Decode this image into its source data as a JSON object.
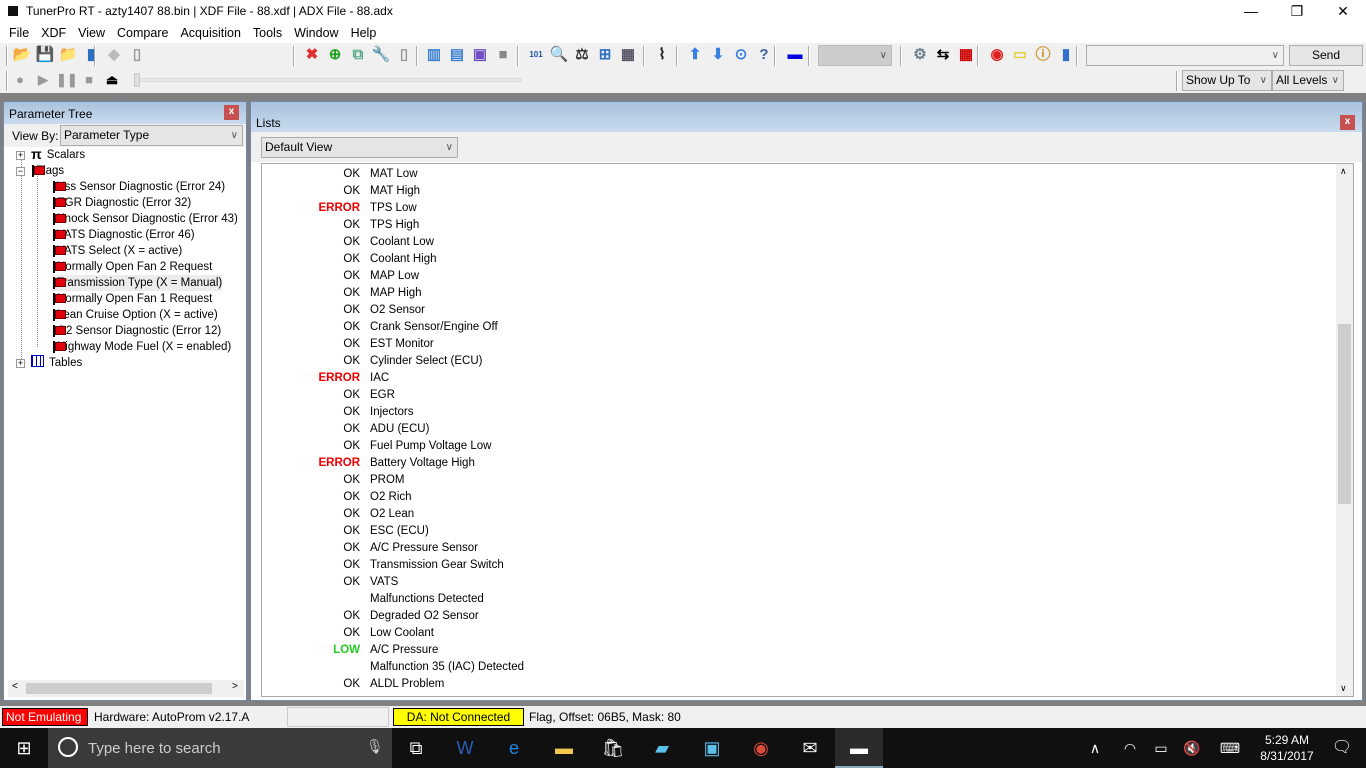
{
  "window": {
    "title": "TunerPro RT - azty1407 88.bin | XDF File - 88.xdf | ADX File - 88.adx",
    "minimize": "—",
    "maximize": "❐",
    "close": "✕"
  },
  "menu": [
    "File",
    "XDF",
    "View",
    "Compare",
    "Acquisition",
    "Tools",
    "Window",
    "Help"
  ],
  "toolbar": {
    "icons1": [
      {
        "name": "open-bin-icon",
        "glyph": "📂",
        "color": "#e0a020"
      },
      {
        "name": "save-icon",
        "glyph": "💾",
        "color": "#3050a0"
      },
      {
        "name": "open-folder-icon",
        "glyph": "📁",
        "color": "#e0a020"
      },
      {
        "name": "xdf-icon",
        "glyph": "▮",
        "color": "#2a70c0"
      },
      {
        "name": "adx-icon",
        "glyph": "◆",
        "color": "#bbb"
      },
      {
        "name": "new-doc-icon",
        "glyph": "▯",
        "color": "#999"
      }
    ],
    "icons2": [
      {
        "name": "delete-icon",
        "glyph": "✖",
        "color": "#e03030"
      },
      {
        "name": "add-icon",
        "glyph": "⊕",
        "color": "#20a020"
      },
      {
        "name": "copy-add-icon",
        "glyph": "⧉",
        "color": "#5a8"
      },
      {
        "name": "wrench-icon",
        "glyph": "🔧",
        "color": "#999"
      },
      {
        "name": "page-icon",
        "glyph": "▯",
        "color": "#999"
      }
    ],
    "icons3": [
      {
        "name": "layout-columns-icon",
        "glyph": "▥",
        "color": "#3a80d0"
      },
      {
        "name": "layout-rows-icon",
        "glyph": "▤",
        "color": "#3a80d0"
      },
      {
        "name": "window-info-icon",
        "glyph": "▣",
        "color": "#7050c0"
      },
      {
        "name": "monitor-icon",
        "glyph": "■",
        "color": "#888"
      }
    ],
    "icons4": [
      {
        "name": "binary-icon",
        "glyph": "101",
        "color": "#2050a0"
      },
      {
        "name": "search-icon",
        "glyph": "🔍",
        "color": "#3070c0"
      },
      {
        "name": "compare-scale-icon",
        "glyph": "⚖",
        "color": "#333"
      },
      {
        "name": "hierarchy-icon",
        "glyph": "⊞",
        "color": "#3070c0"
      },
      {
        "name": "calculator-icon",
        "glyph": "▦",
        "color": "#556"
      }
    ],
    "icons5": [
      {
        "name": "cable-icon",
        "glyph": "⌇",
        "color": "#222"
      }
    ],
    "icons6": [
      {
        "name": "arrow-up-icon",
        "glyph": "⬆",
        "color": "#3a80e0"
      },
      {
        "name": "arrow-down-icon",
        "glyph": "⬇",
        "color": "#3a80e0"
      },
      {
        "name": "download-circle-icon",
        "glyph": "⊙",
        "color": "#3a80e0"
      },
      {
        "name": "help-docs-icon",
        "glyph": "?",
        "color": "#3a60a0"
      }
    ],
    "icons7": [
      {
        "name": "chip-icon",
        "glyph": "▬",
        "color": "#0000e0"
      }
    ],
    "icons8": [
      {
        "name": "gears-icon",
        "glyph": "⚙",
        "color": "#708090"
      },
      {
        "name": "swap-arrows-icon",
        "glyph": "⇆",
        "color": "#000"
      },
      {
        "name": "table-insert-icon",
        "glyph": "▦",
        "color": "#c00"
      }
    ],
    "icons9": [
      {
        "name": "record-stop-icon",
        "glyph": "◉",
        "color": "#e02020"
      },
      {
        "name": "notepad-icon",
        "glyph": "▭",
        "color": "#e0d040"
      },
      {
        "name": "info-clock-icon",
        "glyph": "ⓘ",
        "color": "#d09020"
      },
      {
        "name": "bar-chart-icon",
        "glyph": "▮",
        "color": "#3070d0"
      }
    ],
    "send_label": "Send",
    "playback": [
      {
        "name": "record-icon",
        "glyph": "●",
        "color": "#999"
      },
      {
        "name": "play-icon",
        "glyph": "▶",
        "color": "#999"
      },
      {
        "name": "pause-icon",
        "glyph": "❚❚",
        "color": "#999"
      },
      {
        "name": "stop-icon",
        "glyph": "■",
        "color": "#999"
      },
      {
        "name": "eject-icon",
        "glyph": "⏏",
        "color": "#000"
      }
    ],
    "show_up_to": "Show Up To",
    "all_levels": "All Levels"
  },
  "param_tree": {
    "title": "Parameter Tree",
    "close": "x",
    "view_by_label": "View By:",
    "view_by_value": "Parameter Type",
    "scalars": "Scalars",
    "flags": "Flags",
    "tables": "Tables",
    "flag_items": [
      "Vss Sensor Diagnostic (Error 24)",
      "EGR Diagnostic (Error 32)",
      "Knock Sensor Diagnostic (Error 43)",
      "VATS Diagnostic (Error 46)",
      "VATS Select (X = active)",
      "Normally Open Fan 2 Request",
      "Transmission Type (X = Manual)",
      "Normally Open Fan 1 Request",
      "Lean Cruise Option (X = active)",
      "O2 Sensor Diagnostic (Error 12)",
      "Highway Mode Fuel (X = enabled)"
    ],
    "selected_index": 6
  },
  "lists": {
    "title": "Lists",
    "close": "x",
    "view": "Default View",
    "rows": [
      {
        "status": "OK",
        "name": "MAT Low"
      },
      {
        "status": "OK",
        "name": "MAT High"
      },
      {
        "status": "ERROR",
        "name": "TPS Low"
      },
      {
        "status": "OK",
        "name": "TPS High"
      },
      {
        "status": "OK",
        "name": "Coolant Low"
      },
      {
        "status": "OK",
        "name": "Coolant High"
      },
      {
        "status": "OK",
        "name": "MAP Low"
      },
      {
        "status": "OK",
        "name": "MAP High"
      },
      {
        "status": "OK",
        "name": "O2 Sensor"
      },
      {
        "status": "OK",
        "name": "Crank Sensor/Engine Off"
      },
      {
        "status": "OK",
        "name": "EST Monitor"
      },
      {
        "status": "OK",
        "name": "Cylinder Select (ECU)"
      },
      {
        "status": "ERROR",
        "name": "IAC"
      },
      {
        "status": "OK",
        "name": "EGR"
      },
      {
        "status": "OK",
        "name": "Injectors"
      },
      {
        "status": "OK",
        "name": "ADU (ECU)"
      },
      {
        "status": "OK",
        "name": "Fuel Pump Voltage Low"
      },
      {
        "status": "ERROR",
        "name": "Battery Voltage High"
      },
      {
        "status": "OK",
        "name": "PROM"
      },
      {
        "status": "OK",
        "name": "O2 Rich"
      },
      {
        "status": "OK",
        "name": "O2 Lean"
      },
      {
        "status": "OK",
        "name": "ESC (ECU)"
      },
      {
        "status": "OK",
        "name": "A/C Pressure Sensor"
      },
      {
        "status": "OK",
        "name": "Transmission Gear Switch"
      },
      {
        "status": "OK",
        "name": "VATS"
      },
      {
        "status": "",
        "name": "Malfunctions Detected"
      },
      {
        "status": "OK",
        "name": "Degraded O2 Sensor"
      },
      {
        "status": "OK",
        "name": "Low Coolant"
      },
      {
        "status": "LOW",
        "name": "A/C Pressure"
      },
      {
        "status": "",
        "name": "Malfunction 35 (IAC) Detected"
      },
      {
        "status": "OK",
        "name": "ALDL Problem"
      }
    ],
    "scroll_position": 0.45
  },
  "status": {
    "emulation": "Not Emulating",
    "hardware": "Hardware: AutoProm v2.17.A",
    "da": "DA: Not Connected",
    "flag_info": "Flag, Offset: 06B5,  Mask: 80"
  },
  "taskbar": {
    "search_placeholder": "Type here to search",
    "time": "5:29 AM",
    "date": "8/31/2017"
  },
  "colors": {
    "error": "#ee0000",
    "low": "#22cc22",
    "not_emulating": "#ff0000",
    "da": "#ffff00"
  }
}
